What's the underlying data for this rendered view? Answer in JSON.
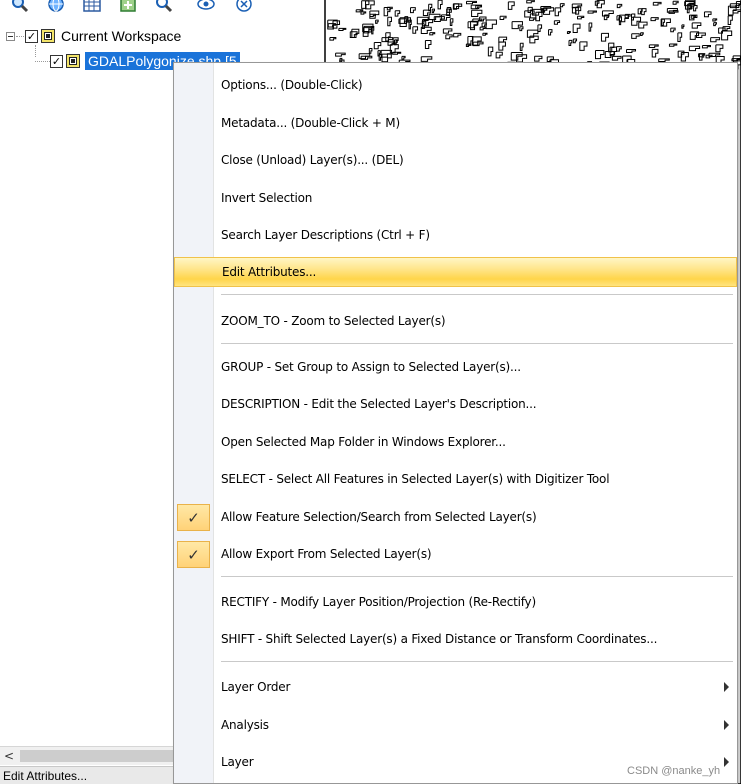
{
  "toolbar": {
    "icons": [
      "zoom-in-icon",
      "globe-icon",
      "table-icon",
      "layer-add-icon",
      "zoom-layer-icon",
      "view-icon",
      "close-circle-icon"
    ]
  },
  "tree": {
    "root_label": "Current Workspace",
    "root_checked": "✓",
    "child_label": "GDALPolygonize.shp [5",
    "child_checked": "✓"
  },
  "scrollbar": {
    "left_arrow": "<"
  },
  "status_bar": {
    "text": "Edit Attributes..."
  },
  "context_menu": {
    "items": [
      {
        "label": "Options... (Double-Click)"
      },
      {
        "label": "Metadata... (Double-Click + M)"
      },
      {
        "label": "Close (Unload) Layer(s)... (DEL)"
      },
      {
        "label": "Invert Selection"
      },
      {
        "label": "Search Layer Descriptions (Ctrl + F)"
      },
      {
        "label": "Edit Attributes...",
        "highlighted": true
      },
      {
        "label": "ZOOM_TO - Zoom to Selected Layer(s)"
      },
      {
        "label": "GROUP - Set Group to Assign to Selected Layer(s)..."
      },
      {
        "label": "DESCRIPTION - Edit the Selected Layer's Description..."
      },
      {
        "label": "Open Selected Map Folder in Windows Explorer..."
      },
      {
        "label": "SELECT - Select All Features in Selected Layer(s) with Digitizer Tool"
      },
      {
        "label": "Allow Feature Selection/Search from Selected Layer(s)",
        "checked": true,
        "check_mark": "✓"
      },
      {
        "label": "Allow Export From Selected Layer(s)",
        "checked": true,
        "check_mark": "✓"
      },
      {
        "label": "RECTIFY - Modify Layer Position/Projection (Re-Rectify)"
      },
      {
        "label": "SHIFT - Shift Selected Layer(s) a Fixed Distance or Transform Coordinates..."
      },
      {
        "label": "Layer Order",
        "submenu": true
      },
      {
        "label": "Analysis",
        "submenu": true
      },
      {
        "label": "Layer",
        "submenu": true
      }
    ]
  },
  "watermark": "CSDN @nanke_yh",
  "colors": {
    "selection_blue": "#1a73d9",
    "highlight_yellow": "#ffd54a",
    "gutter": "#f1f3f8"
  }
}
